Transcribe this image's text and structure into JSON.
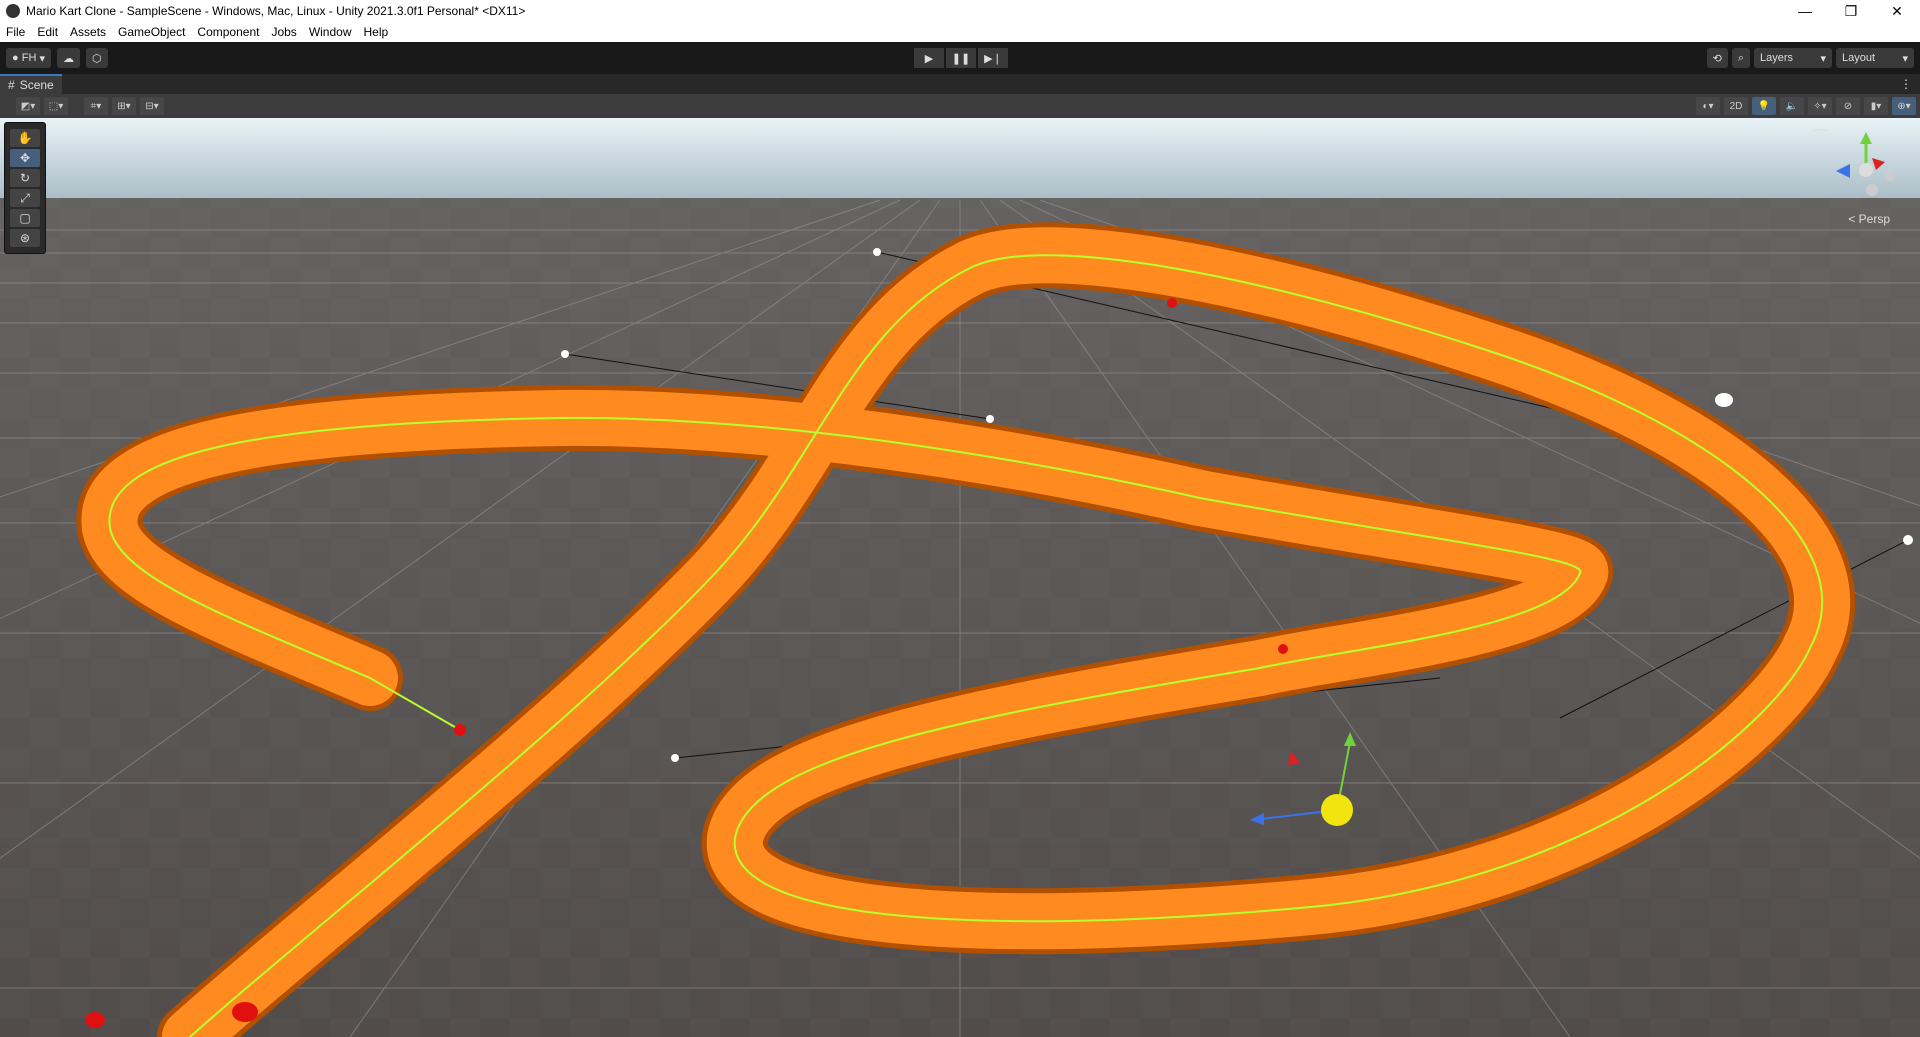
{
  "window": {
    "title": "Mario Kart Clone - SampleScene - Windows, Mac, Linux - Unity 2021.3.0f1 Personal* <DX11>",
    "minimize": "—",
    "maximize": "❐",
    "close": "✕"
  },
  "menu": [
    "File",
    "Edit",
    "Assets",
    "GameObject",
    "Component",
    "Jobs",
    "Window",
    "Help"
  ],
  "toolbar": {
    "account": "FH",
    "play": "▶",
    "pause": "❚❚",
    "step": "▶❘",
    "layers": "Layers",
    "layout": "Layout"
  },
  "scene": {
    "tab": "Scene",
    "mode_2d": "2D",
    "camera_label": "< Persp"
  },
  "tools": [
    {
      "name": "hand-tool-icon",
      "glyph": "✋"
    },
    {
      "name": "move-tool-icon",
      "glyph": "✥"
    },
    {
      "name": "rotate-tool-icon",
      "glyph": "↻"
    },
    {
      "name": "scale-tool-icon",
      "glyph": "⤢"
    },
    {
      "name": "rect-tool-icon",
      "glyph": "▢"
    },
    {
      "name": "transform-tool-icon",
      "glyph": "⊛"
    }
  ],
  "colors": {
    "track": "#ff8a1f",
    "track_dark": "#c45d00",
    "spline": "#b6ff2c",
    "ground": "#585452",
    "sky_top": "#e8f2f6",
    "sky_horizon": "#9db3bf"
  }
}
